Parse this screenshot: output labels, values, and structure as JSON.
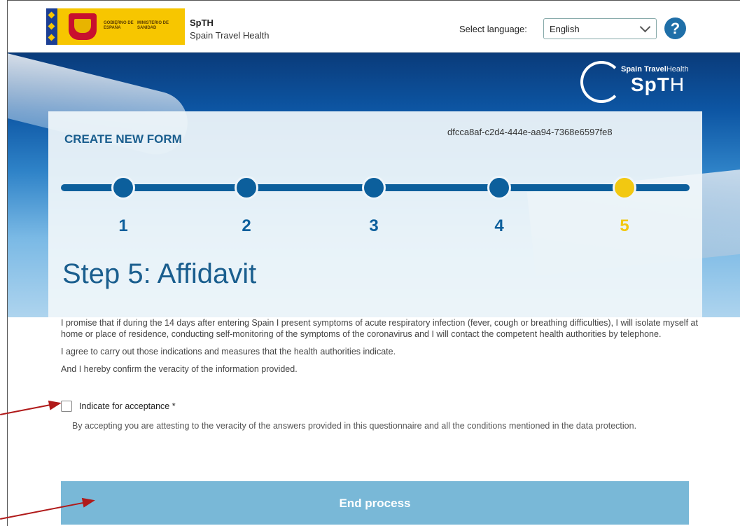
{
  "header": {
    "gov_text_1": "GOBIERNO DE ESPAÑA",
    "gov_text_2": "MINISTERIO DE SANIDAD",
    "app_abbr": "SpTH",
    "app_name": "Spain Travel Health",
    "language_label": "Select language:",
    "language_value": "English",
    "help_symbol": "?"
  },
  "brand": {
    "line1_a": "Spain Travel",
    "line1_b": "Health",
    "logo_a": "SpT",
    "logo_b": "H"
  },
  "form": {
    "title": "CREATE NEW FORM",
    "id": "dfcca8af-c2d4-444e-aa94-7368e6597fe8",
    "steps": [
      "1",
      "2",
      "3",
      "4",
      "5"
    ],
    "current_step": 5,
    "step_title": "Step 5: Affidavit"
  },
  "affidavit": {
    "para1": "I promise that if during the 14 days after entering Spain I present symptoms of acute respiratory infection (fever, cough or breathing difficulties), I will isolate myself at home or place of residence, conducting self-monitoring of the symptoms of the coronavirus and I will contact the competent health authorities by telephone.",
    "para2": "I agree to carry out those indications and measures that the health authorities indicate.",
    "para3": "And I hereby confirm the veracity of the information provided.",
    "accept_label": "Indicate for acceptance *",
    "accept_checked": false,
    "accept_desc": "By accepting you are attesting to the veracity of the answers provided in this questionnaire and all the conditions mentioned in the data protection."
  },
  "actions": {
    "end_label": "End process"
  },
  "colors": {
    "primary": "#0c5f9c",
    "active_step": "#f2c811",
    "button": "#79b8d7",
    "annotation_arrow": "#b01a1a"
  }
}
